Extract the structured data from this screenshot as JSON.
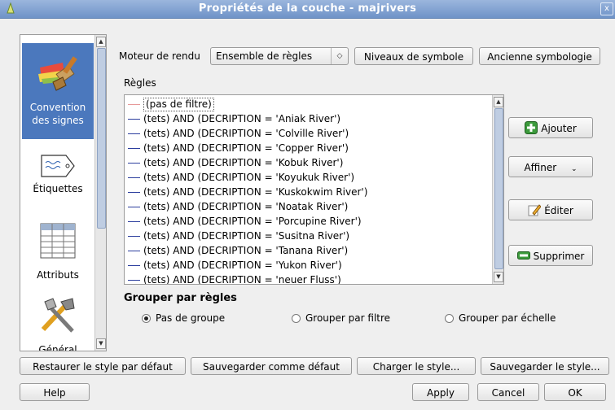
{
  "window": {
    "title": "Propriétés de la couche - majrivers",
    "close_label": "x"
  },
  "sidebar": {
    "items": [
      {
        "label1": "Convention",
        "label2": "des signes",
        "icon": "paintbrush-icon",
        "selected": true
      },
      {
        "label1": "Étiquettes",
        "label2": "",
        "icon": "label-tag-icon",
        "selected": false
      },
      {
        "label1": "Attributs",
        "label2": "",
        "icon": "table-icon",
        "selected": false
      },
      {
        "label1": "Général",
        "label2": "",
        "icon": "tools-icon",
        "selected": false
      }
    ]
  },
  "renderer": {
    "label": "Moteur de rendu",
    "selected": "Ensemble de règles",
    "symbol_levels_button": "Niveaux de symbole",
    "old_symbology_button": "Ancienne symbologie"
  },
  "rules": {
    "heading": "Règles",
    "items": [
      {
        "text": "(pas de filtre)",
        "color": "#e79a9a"
      },
      {
        "text": "(tets) AND (DECRIPTION = 'Aniak River')",
        "color": "#2c3e9e"
      },
      {
        "text": "(tets) AND (DECRIPTION = 'Colville River')",
        "color": "#2c3e9e"
      },
      {
        "text": "(tets) AND (DECRIPTION = 'Copper River')",
        "color": "#2c3e9e"
      },
      {
        "text": "(tets) AND (DECRIPTION = 'Kobuk River')",
        "color": "#2c3e9e"
      },
      {
        "text": "(tets) AND (DECRIPTION = 'Koyukuk River')",
        "color": "#2c3e9e"
      },
      {
        "text": "(tets) AND (DECRIPTION = 'Kuskokwim River')",
        "color": "#2c3e9e"
      },
      {
        "text": "(tets) AND (DECRIPTION = 'Noatak River')",
        "color": "#2c3e9e"
      },
      {
        "text": "(tets) AND (DECRIPTION = 'Porcupine River')",
        "color": "#2c3e9e"
      },
      {
        "text": "(tets) AND (DECRIPTION = 'Susitna River')",
        "color": "#2c3e9e"
      },
      {
        "text": "(tets) AND (DECRIPTION = 'Tanana River')",
        "color": "#2c3e9e"
      },
      {
        "text": "(tets) AND (DECRIPTION = 'Yukon River')",
        "color": "#2c3e9e"
      },
      {
        "text": "(tets) AND (DECRIPTION = 'neuer Fluss')",
        "color": "#2c3e9e"
      }
    ],
    "add_button": "Ajouter",
    "refine_button": "Affiner",
    "edit_button": "Éditer",
    "delete_button": "Supprimer"
  },
  "grouping": {
    "title": "Grouper par règles",
    "options": [
      {
        "label": "Pas de groupe",
        "checked": true
      },
      {
        "label": "Grouper par filtre",
        "checked": false
      },
      {
        "label": "Grouper par échelle",
        "checked": false
      }
    ]
  },
  "style_buttons": {
    "restore": "Restaurer le style par défaut",
    "save_default": "Sauvegarder comme défaut",
    "load": "Charger le style...",
    "save": "Sauvegarder le style..."
  },
  "footer": {
    "help": "Help",
    "apply": "Apply",
    "cancel": "Cancel",
    "ok": "OK"
  }
}
